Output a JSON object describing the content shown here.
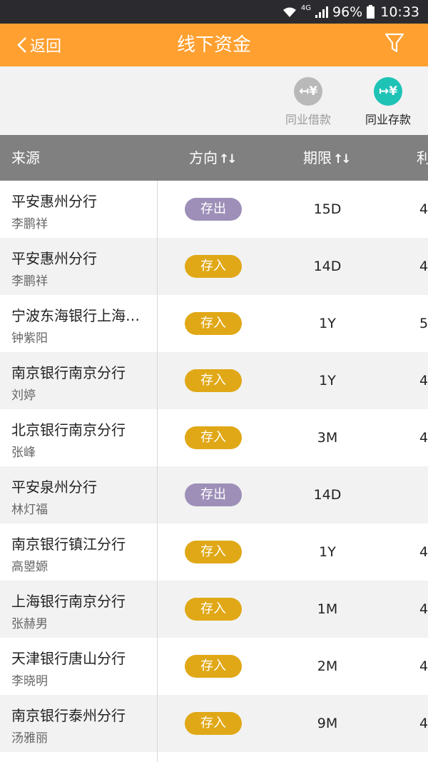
{
  "status_bar": {
    "network": "4G",
    "battery": "96%",
    "time": "10:33"
  },
  "header": {
    "back_label": "返回",
    "title": "线下资金",
    "accent_color": "#ffa030"
  },
  "toggles": {
    "borrow": {
      "symbol": "↤¥",
      "label": "同业借款",
      "active": false
    },
    "deposit": {
      "symbol": "↦¥",
      "label": "同业存款",
      "active": true
    }
  },
  "table": {
    "columns": {
      "source": "来源",
      "direction": "方向",
      "term": "期限",
      "rate": "利"
    },
    "sort_symbol": "↑↓",
    "rows": [
      {
        "bank": "平安惠州分行",
        "person": "李鹏祥",
        "direction": "存出",
        "type": "out",
        "term": "15D",
        "rate": "4"
      },
      {
        "bank": "平安惠州分行",
        "person": "李鹏祥",
        "direction": "存入",
        "type": "in",
        "term": "14D",
        "rate": "4"
      },
      {
        "bank": "宁波东海银行上海…",
        "person": "钟紫阳",
        "direction": "存入",
        "type": "in",
        "term": "1Y",
        "rate": "5"
      },
      {
        "bank": "南京银行南京分行",
        "person": "刘婷",
        "direction": "存入",
        "type": "in",
        "term": "1Y",
        "rate": "4"
      },
      {
        "bank": "北京银行南京分行",
        "person": "张峰",
        "direction": "存入",
        "type": "in",
        "term": "3M",
        "rate": "4"
      },
      {
        "bank": "平安泉州分行",
        "person": "林灯福",
        "direction": "存出",
        "type": "out",
        "term": "14D",
        "rate": ""
      },
      {
        "bank": "南京银行镇江分行",
        "person": "高曌嫄",
        "direction": "存入",
        "type": "in",
        "term": "1Y",
        "rate": "4"
      },
      {
        "bank": "上海银行南京分行",
        "person": "张赫男",
        "direction": "存入",
        "type": "in",
        "term": "1M",
        "rate": "4"
      },
      {
        "bank": "天津银行唐山分行",
        "person": "李晓明",
        "direction": "存入",
        "type": "in",
        "term": "2M",
        "rate": "4"
      },
      {
        "bank": "南京银行泰州分行",
        "person": "汤雅丽",
        "direction": "存入",
        "type": "in",
        "term": "9M",
        "rate": "4"
      }
    ]
  }
}
